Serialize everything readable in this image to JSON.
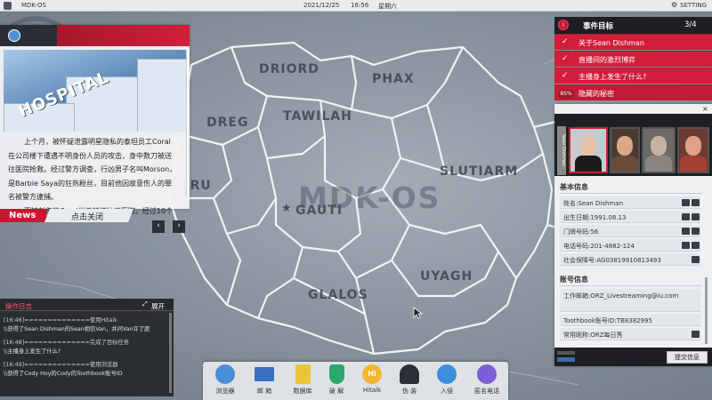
{
  "topbar": {
    "os_name": "MDK-OS",
    "date": "2021/12/25",
    "time": "16:56",
    "weekday": "星期六",
    "setting_label": "SETTING",
    "gear_icon": "gear-icon"
  },
  "map": {
    "watermark": "MDK-OS",
    "regions": [
      "DRIORD",
      "PHAX",
      "DREG",
      "TAWILAH",
      "SLUTIARM",
      "DRU",
      "GAUTI",
      "UYAGH",
      "GLALOS"
    ],
    "capital_marker": "★"
  },
  "news": {
    "photo_sign": "HOSPITAL",
    "story": [
      "上个月，被怀疑泄露明星隐私的泰坦员工Coral在公司楼下遭遇不明身份人员的攻击，身中数刀被送往医院抢救。经过警方调查，行凶男子名叫Morson，是Barbie Saya的狂热粉丝，目前他因故意伤人的罪名被警方逮捕。",
      "而被刺伤的Coral当天被送往了医院，经过10个"
    ],
    "prev_label": "‹",
    "next_label": "›",
    "tag": "News",
    "close_label": "点击关闭"
  },
  "log": {
    "title": "操作日志",
    "expand_label": "展开",
    "entries": [
      {
        "ts": "[16:46]==============使用Hitalk",
        "text": "\\\\获得了Sean Dishman的Sean相信Van，并问Van许了愿"
      },
      {
        "ts": "[16:48]==============完成了目标任务",
        "text": "\\\\主播身上发生了什么?"
      },
      {
        "ts": "[16:49]==============使用浏览器",
        "text": "\\\\获得了Cody Hoy的Cody的Toothbook账号ID"
      }
    ]
  },
  "dock": {
    "items": [
      {
        "label": "浏览器",
        "icon": "browser-icon",
        "color": "#4a8fd8"
      },
      {
        "label": "邮 箱",
        "icon": "mail-icon",
        "color": "#3a6fc4"
      },
      {
        "label": "数据库",
        "icon": "database-icon",
        "color": "#e8c53a"
      },
      {
        "label": "破 解",
        "icon": "shield-icon",
        "color": "#2aa86a"
      },
      {
        "label": "Hitalk",
        "icon": "hitalk-icon",
        "color": "#f2b531"
      },
      {
        "label": "伪 装",
        "icon": "disguise-icon",
        "color": "#2c2f36"
      },
      {
        "label": "入侵",
        "icon": "hack-icon",
        "color": "#3c8fe0"
      },
      {
        "label": "匿名电话",
        "icon": "phone-icon",
        "color": "#7a5fd6"
      }
    ],
    "hitalk_badge": "Hi"
  },
  "objectives": {
    "title": "事件目标",
    "count": "3/4",
    "items": [
      {
        "text": "关于Sean Dishman",
        "done": true
      },
      {
        "text": "直播间的激烈博弈",
        "done": true
      },
      {
        "text": "主播身上发生了什么?",
        "done": true
      },
      {
        "text": "隐藏的秘密",
        "done": false,
        "progress": "85%"
      }
    ],
    "check": "✓"
  },
  "profile": {
    "close": "×",
    "vertical_tab": "Sean Dishman",
    "basic_title": "基本信息",
    "basic_fields": [
      "姓名:Sean Dishman",
      "出生日期:1991.08.13",
      "门牌号码:56",
      "电话号码:201-4882-124",
      "社会保障号:AG03819910813493"
    ],
    "account_title": "账号信息",
    "account_fields": [
      "工作邮箱:ORZ_Livestreaming@iu.com",
      "Toothbook账号ID:TB8382995",
      "常用昵称:ORZ每日秀"
    ],
    "submit_label": "提交信息"
  },
  "colors": {
    "accent": "#d21e3a",
    "dark": "#1e1f24"
  }
}
